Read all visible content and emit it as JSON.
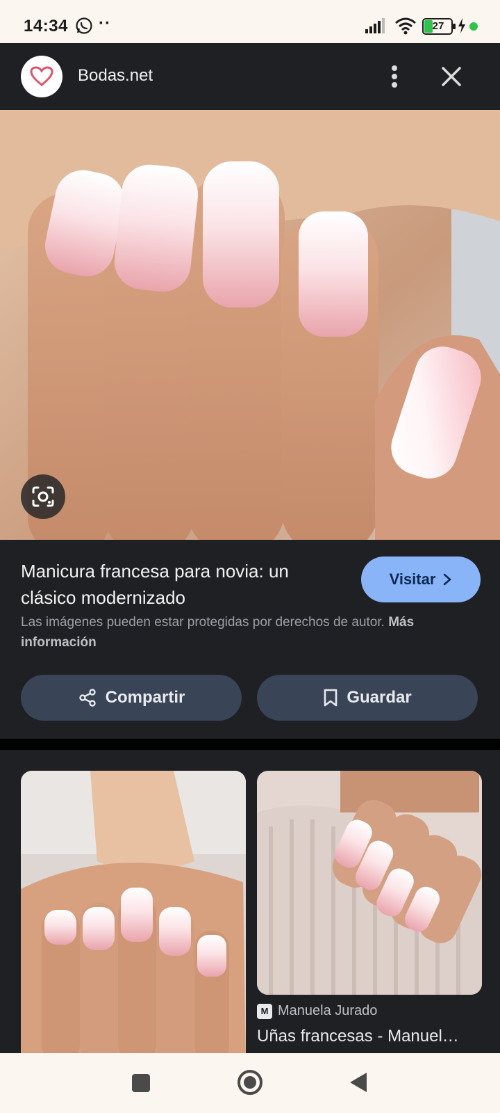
{
  "status_bar": {
    "time": "14:34",
    "extra": "··",
    "battery": "27",
    "battery_color": "#2fc24d"
  },
  "header": {
    "site_name": "Bodas.net",
    "avatar_icon": "heart-icon",
    "accent": "#e0526b"
  },
  "result": {
    "title": "Manicura francesa para novia: un clásico modernizado",
    "visit_label": "Visitar",
    "copyright_text": "Las imágenes pueden estar protegidas por derechos de autor.",
    "copyright_more": "Más información",
    "share_label": "Compartir",
    "save_label": "Guardar"
  },
  "related": [
    {
      "source": "",
      "title": ""
    },
    {
      "source_icon": "M",
      "source": "Manuela Jurado",
      "title": "Uñas francesas - Manuel…"
    }
  ],
  "colors": {
    "background": "#1f2023",
    "visit_button": "#8ab4f8",
    "action_button": "#394457"
  }
}
